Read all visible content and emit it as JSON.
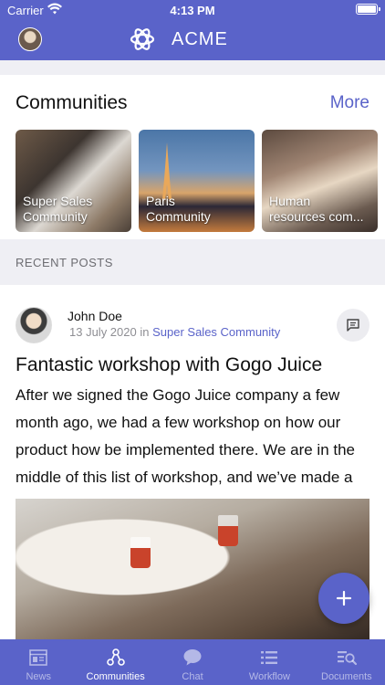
{
  "status_bar": {
    "carrier": "Carrier",
    "time": "4:13 PM"
  },
  "nav": {
    "brand": "ACME"
  },
  "communities": {
    "title": "Communities",
    "more_label": "More",
    "items": [
      {
        "label": "Super Sales\nCommunity"
      },
      {
        "label": "Paris\nCommunity"
      },
      {
        "label": "Human\nresources com..."
      }
    ]
  },
  "recent_posts": {
    "header": "RECENT POSTS",
    "post": {
      "author": "John Doe",
      "date": "13 July 2020",
      "in_word": "in",
      "community": "Super Sales Community",
      "title": "Fantastic workshop with Gogo Juice",
      "body": "After we signed the Gogo Juice company a few month ago, we had a few workshop on how our product how be implemented there. We are in the middle of this list of workshop, and we’ve made a"
    }
  },
  "tabbar": {
    "tabs": [
      {
        "label": "News",
        "icon": "news-icon"
      },
      {
        "label": "Communities",
        "icon": "communities-icon"
      },
      {
        "label": "Chat",
        "icon": "chat-icon"
      },
      {
        "label": "Workflow",
        "icon": "workflow-icon"
      },
      {
        "label": "Documents",
        "icon": "documents-icon"
      }
    ],
    "active": "Communities"
  },
  "colors": {
    "accent": "#5a63c9",
    "background": "#efeff4"
  }
}
